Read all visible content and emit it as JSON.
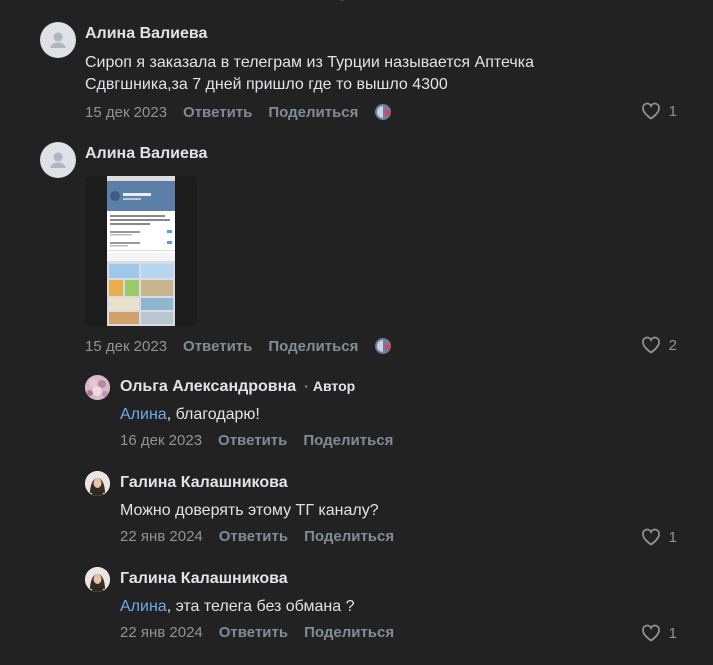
{
  "comments": [
    {
      "author": "Алина Валиева",
      "text_line1": "Сироп я заказала в телеграм из Турции называется Аптечка",
      "text_line2": "Сдвгшника,за 7 дней пришло где то вышло 4300",
      "date": "15 дек 2023",
      "reply_label": "Ответить",
      "share_label": "Поделиться",
      "likes": "1"
    },
    {
      "author": "Алина Валиева",
      "date": "15 дек 2023",
      "reply_label": "Ответить",
      "share_label": "Поделиться",
      "likes": "2"
    }
  ],
  "replies": [
    {
      "author": "Ольга Александровна",
      "badge": "Автор",
      "mention": "Алина",
      "text": ", благодарю!",
      "date": "16 дек 2023",
      "reply_label": "Ответить",
      "share_label": "Поделиться"
    },
    {
      "author": "Галина Калашникова",
      "text": "Можно доверять этому ТГ каналу?",
      "date": "22 янв 2024",
      "reply_label": "Ответить",
      "share_label": "Поделиться",
      "likes": "1"
    },
    {
      "author": "Галина Калашникова",
      "mention": "Алина",
      "text": ", эта телега без обмана ?",
      "date": "22 янв 2024",
      "reply_label": "Ответить",
      "share_label": "Поделиться",
      "likes": "1"
    }
  ]
}
